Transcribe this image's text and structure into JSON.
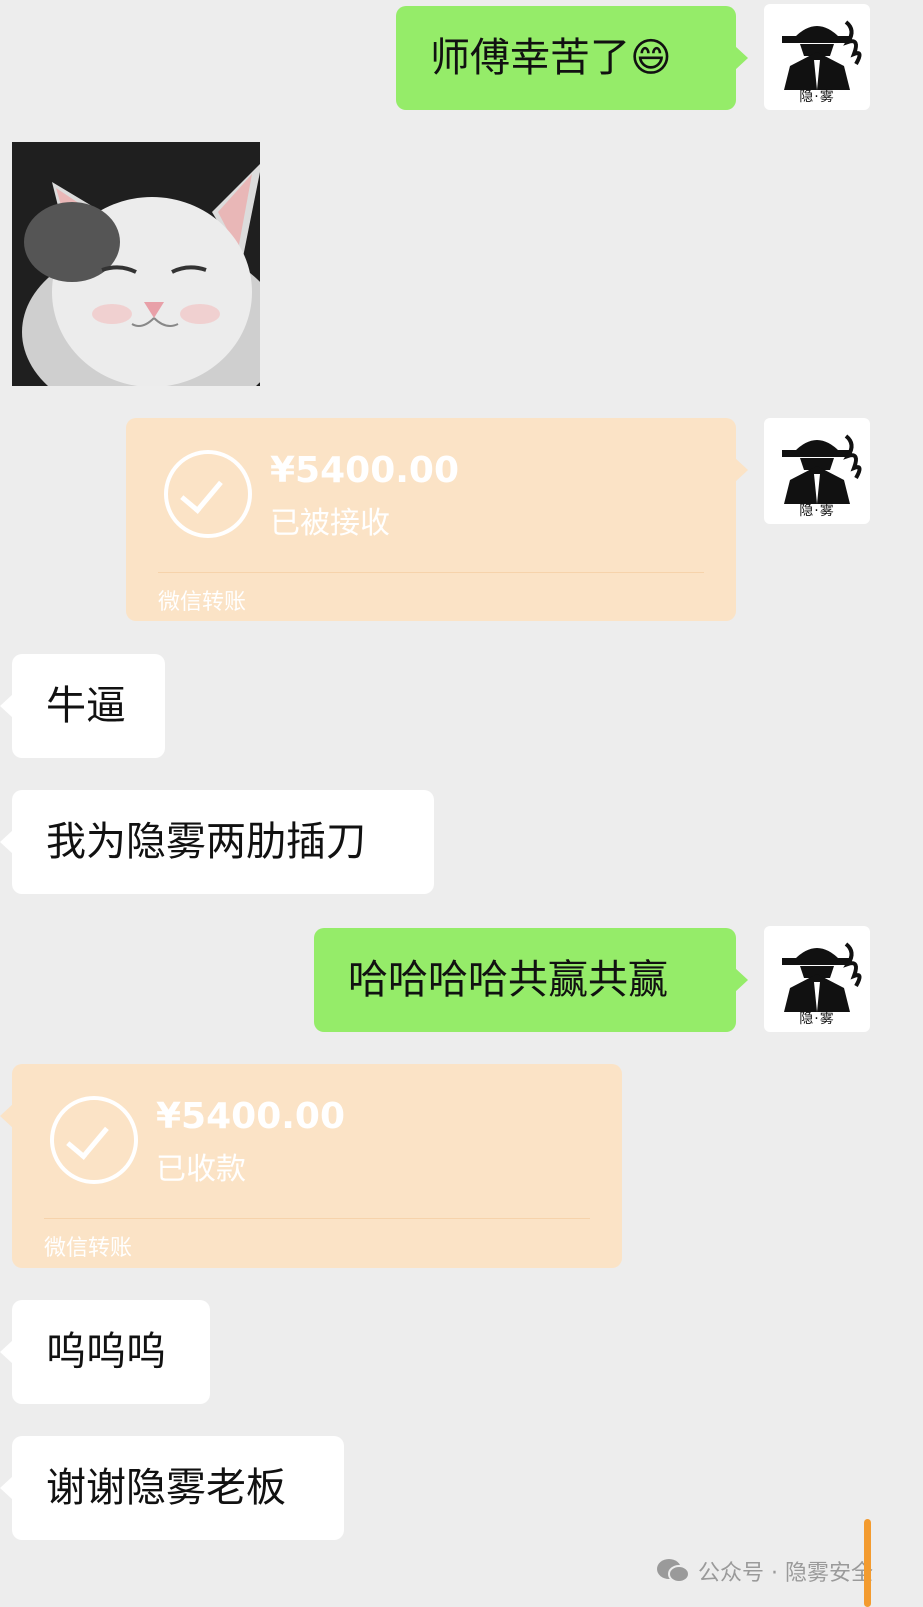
{
  "messages": {
    "m1": {
      "text": "师傅幸苦了😄",
      "side": "right",
      "type": "text"
    },
    "m3": {
      "amount": "¥5400.00",
      "status": "已被接收",
      "footer": "微信转账",
      "side": "right"
    },
    "m4": {
      "text": "牛逼",
      "side": "left"
    },
    "m5": {
      "text": "我为隐雾两肋插刀",
      "side": "left"
    },
    "m6": {
      "text": "哈哈哈哈共赢共赢",
      "side": "right"
    },
    "m7": {
      "amount": "¥5400.00",
      "status": "已收款",
      "footer": "微信转账",
      "side": "left"
    },
    "m8": {
      "text": "呜呜呜",
      "side": "left"
    },
    "m9": {
      "text": "谢谢隐雾老板",
      "side": "left"
    }
  },
  "avatar": {
    "name": "隐·雾",
    "icon": "spy-hat-icon"
  },
  "watermark": {
    "text": "公众号 · 隐雾安全",
    "icon": "wechat-icon"
  },
  "colors": {
    "background": "#ededed",
    "green_bubble": "#95ec69",
    "white_bubble": "#ffffff",
    "transfer_card": "#fbe3c6",
    "accent_bar": "#f39b2f"
  }
}
